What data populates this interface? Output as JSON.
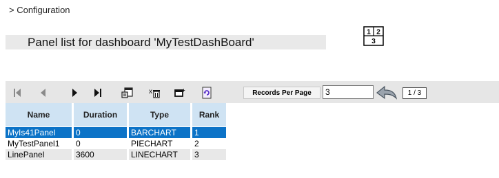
{
  "breadcrumb": "> Configuration",
  "title": "Panel list for dashboard 'MyTestDashBoard'",
  "layout_icon": {
    "cells": [
      "1",
      "2",
      "3"
    ]
  },
  "toolbar": {
    "buttons": [
      {
        "name": "first-page-icon"
      },
      {
        "name": "prev-page-icon"
      },
      {
        "name": "next-page-icon"
      },
      {
        "name": "last-page-icon"
      },
      {
        "name": "properties-icon"
      },
      {
        "name": "delete-icon"
      },
      {
        "name": "add-icon"
      },
      {
        "name": "refresh-icon"
      }
    ],
    "records_per_page_label": "Records Per Page",
    "records_per_page_value": "3",
    "page_indicator": "1 / 3"
  },
  "table": {
    "columns": [
      "Name",
      "Duration",
      "Type",
      "Rank"
    ],
    "rows": [
      [
        "MyIs41Panel",
        "0",
        "BARCHART",
        "1"
      ],
      [
        "MyTestPanel1",
        "0",
        "PIECHART",
        "2"
      ],
      [
        "LinePanel",
        "3600",
        "LINECHART",
        "3"
      ]
    ],
    "selected_row": 0
  },
  "colors": {
    "header_bg": "#cfe3f3",
    "selected_bg": "#0c73c7",
    "toolbar_bg": "#e6e6e6",
    "title_bg": "#e9e9e9"
  }
}
